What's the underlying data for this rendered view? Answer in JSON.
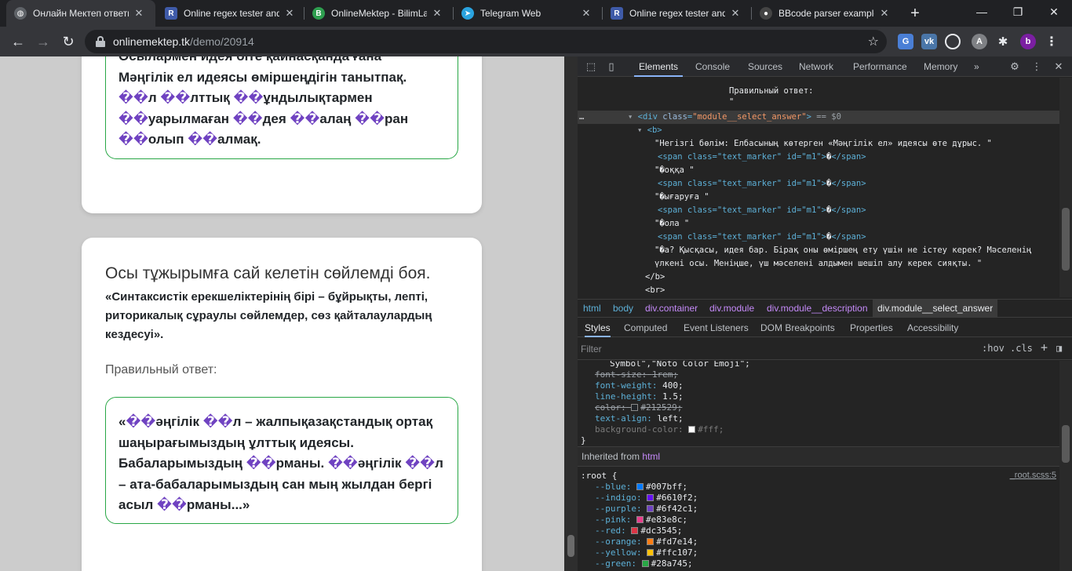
{
  "browser": {
    "tabs": [
      {
        "title": "Онлайн Мектеп ответы",
        "active": true
      },
      {
        "title": "Online regex tester and",
        "active": false
      },
      {
        "title": "OnlineMektep - BilimLa",
        "active": false
      },
      {
        "title": "Telegram Web",
        "active": false
      },
      {
        "title": "Online regex tester and",
        "active": false
      },
      {
        "title": "BBcode parser example",
        "active": false
      }
    ],
    "url_host": "onlinemektep.tk",
    "url_path": "/demo/20914",
    "profile_letter": "b",
    "ext_a_letter": "A"
  },
  "page": {
    "card1_answer": "Осылармен идея біте қайнасқанда ғана\nМәңгілік ел идеясы өміршеңдігін танытпақ.\n��л ��лттық ��ұндылықтармен\n��уарылмаған ��дея ��алаң ��ран\n��олып ��алмақ.",
    "card2_title": "Осы тұжырымға сай келетін сөйлемді боя.",
    "card2_quote": "«Синтаксистік ерекшеліктерінің бірі – бұйрықты, лепті,\nриторикалық сұраулы сөйлемдер, сөз қайталаулардың\nкездесуі».",
    "card2_label": "Правильный ответ:",
    "card2_answer": "«��әңгілік ��л – жалпықазақстандық ортақ\nшаңырағымыздың ұлттық идеясы.\nБабаларымыздың ��рманы. ��әңгілік ��л\n– ата-бабаларымыздың сан мың жылдан бергі\nасыл ��рманы...»"
  },
  "devtools": {
    "tabs": [
      "Elements",
      "Console",
      "Sources",
      "Network",
      "Performance",
      "Memory"
    ],
    "more": "»",
    "dom": {
      "q1": "\"",
      "text1": "Правильный ответ:",
      "q2": "\"",
      "div_open_tag": "div",
      "class_attr": "class",
      "class_val": "\"module__select_answer\"",
      "div_sel_suffix": "== $0",
      "b_open": "<b>",
      "text_main": "\"Негізгі бөлім: Елбасының көтерген «Мәңгілік ел» идеясы өте дұрыс. \"",
      "span_tag": "<span class=\"text_marker\" id=\"m1\">",
      "span_close": "</span>",
      "marker": "�",
      "t_okka": "\"�оққа \"",
      "t_shygaruga": "\"�ығаруға \"",
      "t_ola": "\"�ола \"",
      "t_last1": "\"�а? Қысқасы, идея бар. Бірақ оны өміршең ету үшін не істеу керек? Мәселенің",
      "t_last2": "үлкені осы. Меніңше, үш мәселені алдымен шешіп алу керек сияқты. \"",
      "b_close": "</b>",
      "br": "<br>",
      "dots": "…"
    },
    "breadcrumbs": [
      "html",
      "body",
      "div.container",
      "div.module",
      "div.module__description",
      "div.module__select_answer"
    ],
    "subtabs": [
      "Styles",
      "Computed",
      "Event Listeners",
      "DOM Breakpoints",
      "Properties",
      "Accessibility"
    ],
    "filter_placeholder": "Filter",
    "hov": ":hov",
    "cls": ".cls",
    "styles": {
      "font_family_tail": "Symbol\",\"Noto Color Emoji\";",
      "p_font_size": "font-size:",
      "v_font_size": "1rem;",
      "p_font_weight": "font-weight:",
      "v_font_weight": "400;",
      "p_line_height": "line-height:",
      "v_line_height": "1.5;",
      "p_color": "color:",
      "v_color": "#212529;",
      "p_text_align": "text-align:",
      "v_text_align": "left;",
      "p_bg": "background-color:",
      "v_bg": "#fff;",
      "close_brace": "}",
      "inherited_label": "Inherited from",
      "inherited_tag": "html",
      "root_sel": ":root",
      "open_brace": "{",
      "root_src": "_root.scss:5",
      "vars": [
        {
          "name": "--blue:",
          "value": "#007bff;",
          "color": "#007bff"
        },
        {
          "name": "--indigo:",
          "value": "#6610f2;",
          "color": "#6610f2"
        },
        {
          "name": "--purple:",
          "value": "#6f42c1;",
          "color": "#6f42c1"
        },
        {
          "name": "--pink:",
          "value": "#e83e8c;",
          "color": "#e83e8c"
        },
        {
          "name": "--red:",
          "value": "#dc3545;",
          "color": "#dc3545"
        },
        {
          "name": "--orange:",
          "value": "#fd7e14;",
          "color": "#fd7e14"
        },
        {
          "name": "--yellow:",
          "value": "#ffc107;",
          "color": "#ffc107"
        },
        {
          "name": "--green:",
          "value": "#28a745;",
          "color": "#28a745"
        }
      ]
    }
  }
}
